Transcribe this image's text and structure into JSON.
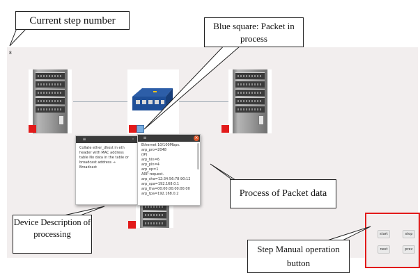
{
  "step_number": "8",
  "description_window": {
    "title_icon": "menu-icon",
    "text": "Collate ether_dhost in eth header with MAC address table No data in the table or broadcast address → Broadcast"
  },
  "packet_window": {
    "close_icon": "close-icon",
    "lines": [
      "Ethernet 10/100Mbps.",
      "arp_pro=2048",
      "(IP)",
      "arp_hln=6",
      "arp_pln=4",
      "arp_op=1",
      "ARP request.",
      "arp_sha=12:34:56:78:90:12",
      "arp_spa=192.168.0.1",
      "arp_tha=00:00:00:00:00:00",
      "arp_tpa=192.168.0.2"
    ]
  },
  "buttons": {
    "start": "start",
    "stop": "stop",
    "next": "next",
    "prev": "prev"
  },
  "callouts": {
    "current_step": "Current step number",
    "blue_square": "Blue square: Packet in process",
    "process_packet": "Process of Packet data",
    "device_description": "Device Description of processing",
    "step_manual": "Step Manual operation button"
  },
  "colors": {
    "device_marker": "#e21a1a",
    "packet_marker": "#7aaee0",
    "canvas_bg": "#f2eeee",
    "panel_border": "#e21a1a"
  }
}
